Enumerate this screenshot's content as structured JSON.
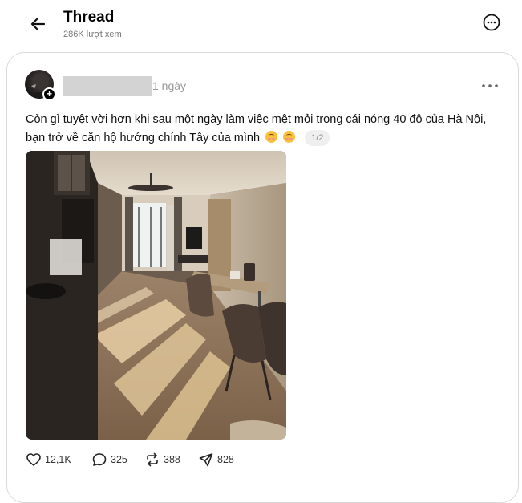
{
  "header": {
    "title": "Thread",
    "views": "286K lượt xem"
  },
  "post": {
    "time": "1 ngày",
    "text": "Còn gì tuyệt vời hơn khi sau một ngày làm việc mệt mỏi trong cái nóng 40 độ của Hà Nội, bạn trở về căn hộ hướng chính Tây của mình",
    "emojis": [
      "smiling-face-icon",
      "smiling-face-icon"
    ],
    "pager": "1/2",
    "image": "apartment-living-room-photo",
    "stats": {
      "likes": "12,1K",
      "comments": "325",
      "reposts": "388",
      "shares": "828"
    }
  }
}
